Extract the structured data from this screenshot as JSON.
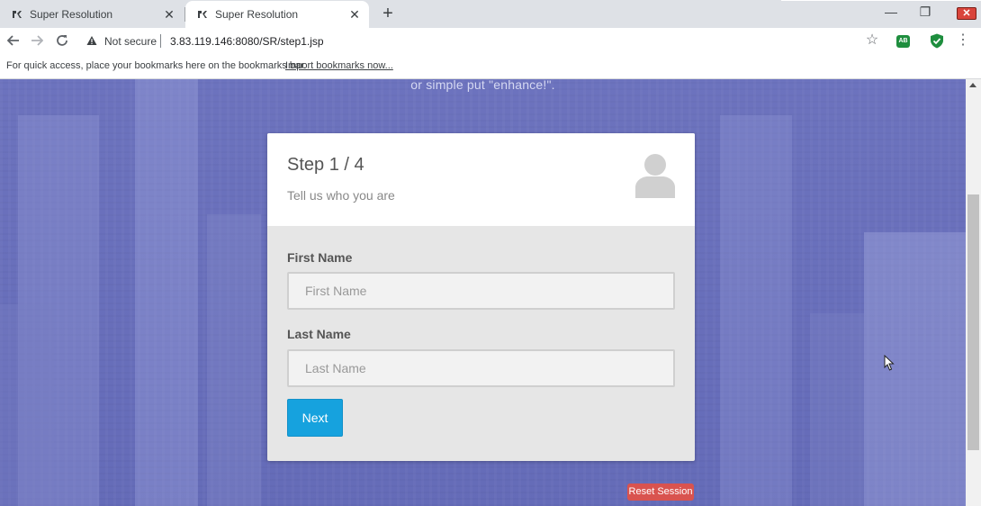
{
  "browser": {
    "tabs": [
      {
        "title": "Super Resolution",
        "active": false
      },
      {
        "title": "Super Resolution",
        "active": true
      }
    ],
    "new_tab_symbol": "+",
    "window_controls": {
      "minimize": "—",
      "restore": "❐",
      "close": "✕"
    },
    "address_bar": {
      "security_label": "Not secure",
      "url": "3.83.119.146:8080/SR/step1.jsp"
    },
    "bookmarks_bar": {
      "hint": "For quick access, place your bookmarks here on the bookmarks bar.",
      "import_link": "Import bookmarks now..."
    },
    "extensions": {
      "adblock_label": "AB"
    }
  },
  "page": {
    "tagline": "or simple put \"enhance!\".",
    "card": {
      "step": "Step 1 / 4",
      "subtitle": "Tell us who you are",
      "first_name_label": "First Name",
      "first_name_placeholder": "First Name",
      "first_name_value": "",
      "last_name_label": "Last Name",
      "last_name_placeholder": "Last Name",
      "last_name_value": "",
      "next_button": "Next"
    },
    "reset_button": "Reset Session"
  },
  "colors": {
    "accent_button": "#16a2de",
    "reset_button": "#d9534f",
    "page_tint": "#6a6fb6"
  }
}
